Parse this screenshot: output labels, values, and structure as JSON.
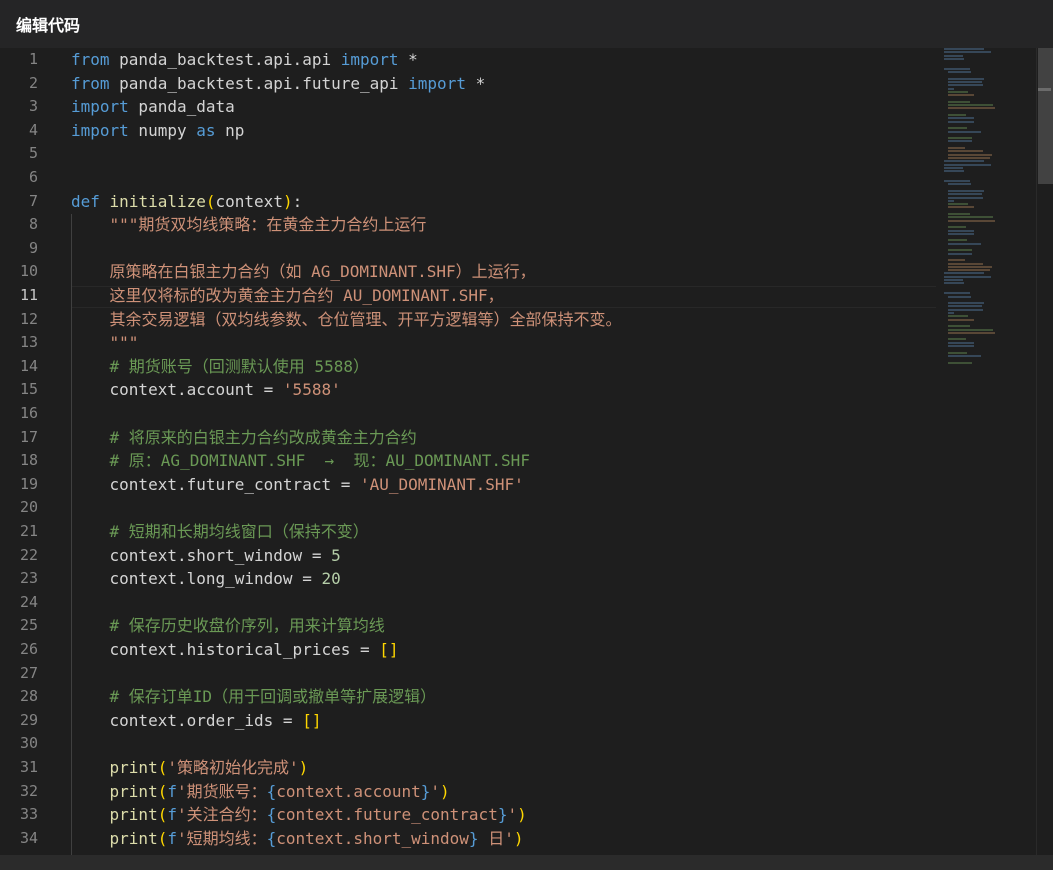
{
  "window": {
    "title": "编辑代码"
  },
  "editor": {
    "active_line": 11,
    "line_numbers": [
      "1",
      "2",
      "3",
      "4",
      "5",
      "6",
      "7",
      "8",
      "9",
      "10",
      "11",
      "12",
      "13",
      "14",
      "15",
      "16",
      "17",
      "18",
      "19",
      "20",
      "21",
      "22",
      "23",
      "24",
      "25",
      "26",
      "27",
      "28",
      "29",
      "30",
      "31",
      "32",
      "33",
      "34"
    ],
    "lines": [
      "from panda_backtest.api.api import *",
      "from panda_backtest.api.future_api import *",
      "import panda_data",
      "import numpy as np",
      "",
      "",
      "def initialize(context):",
      "    \"\"\"期货双均线策略：在黄金主力合约上运行",
      "",
      "    原策略在白银主力合约（如 AG_DOMINANT.SHF）上运行，",
      "    这里仅将标的改为黄金主力合约 AU_DOMINANT.SHF，",
      "    其余交易逻辑（双均线参数、仓位管理、开平方逻辑等）全部保持不变。",
      "    \"\"\"",
      "    # 期货账号（回测默认使用 5588）",
      "    context.account = '5588'",
      "",
      "    # 将原来的白银主力合约改成黄金主力合约",
      "    # 原：AG_DOMINANT.SHF  →  现：AU_DOMINANT.SHF",
      "    context.future_contract = 'AU_DOMINANT.SHF'",
      "",
      "    # 短期和长期均线窗口（保持不变）",
      "    context.short_window = 5",
      "    context.long_window = 20",
      "",
      "    # 保存历史收盘价序列，用来计算均线",
      "    context.historical_prices = []",
      "",
      "    # 保存订单ID（用于回调或撤单等扩展逻辑）",
      "    context.order_ids = []",
      "",
      "    print('策略初始化完成')",
      "    print(f'期货账号：{context.account}')",
      "    print(f'关注合约：{context.future_contract}')",
      "    print(f'短期均线：{context.short_window} 日')"
    ]
  },
  "colors": {
    "background": "#1e1e1e",
    "titlebar": "#252526",
    "keyword": "#569cd6",
    "function": "#dcdcaa",
    "string": "#ce9178",
    "comment": "#6a9955",
    "number": "#b5cea8",
    "bracket": "#ffd700"
  }
}
